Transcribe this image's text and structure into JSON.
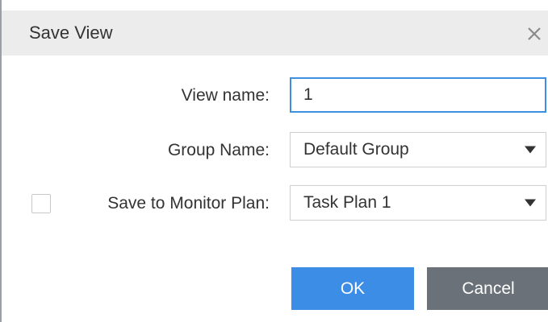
{
  "dialog": {
    "title": "Save View",
    "close_icon": "close-icon"
  },
  "form": {
    "view_name_label": "View name:",
    "view_name_value": "1",
    "group_name_label": "Group Name:",
    "group_name_value": "Default Group",
    "monitor_plan_label": "Save to Monitor Plan:",
    "monitor_plan_value": "Task Plan 1",
    "monitor_plan_checked": false
  },
  "buttons": {
    "ok_label": "OK",
    "cancel_label": "Cancel"
  },
  "colors": {
    "primary": "#3c8de6",
    "secondary": "#6a7178",
    "focus_border": "#3f8fe0",
    "titlebar": "#ececec"
  }
}
